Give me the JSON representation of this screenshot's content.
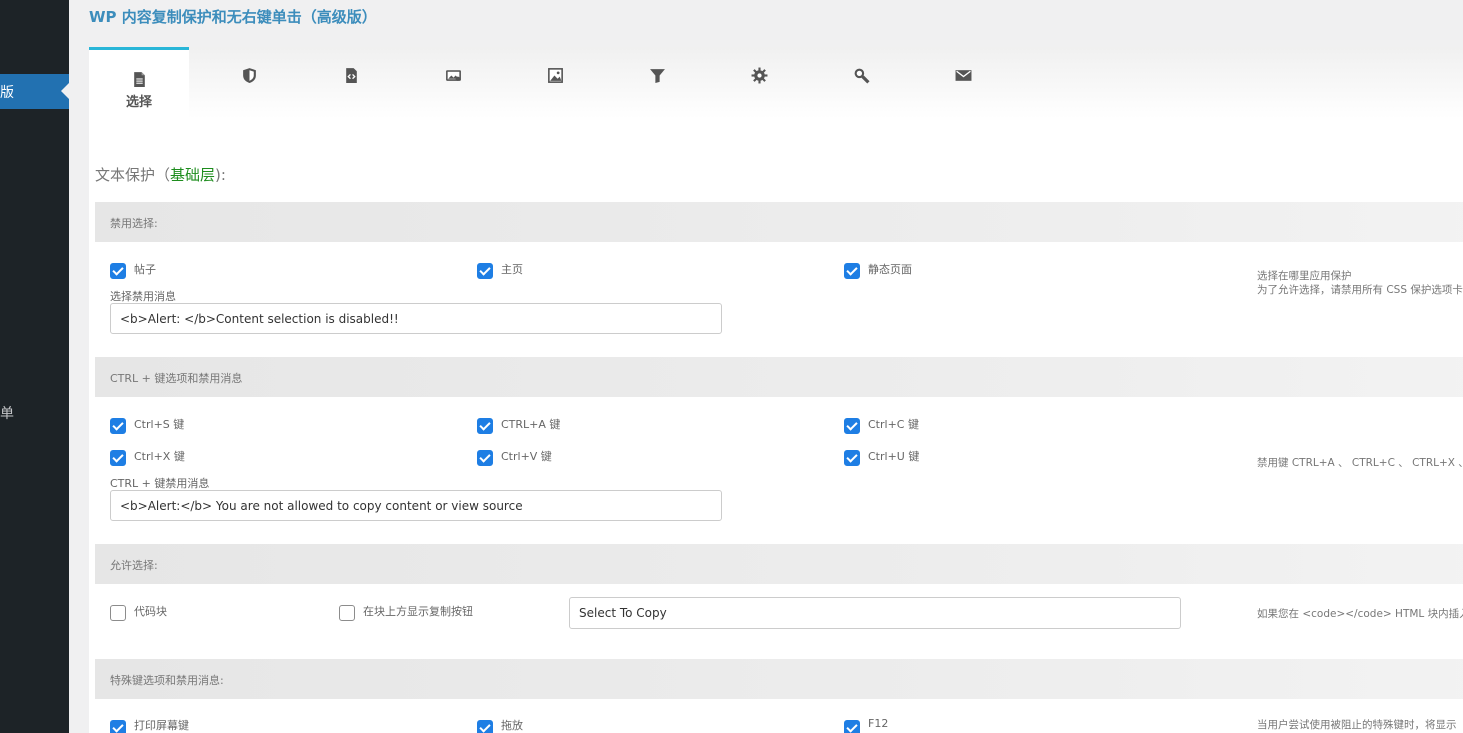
{
  "sidebar": {
    "active_label": "版",
    "item_label": "单"
  },
  "page": {
    "title": "WP 内容复制保护和无右键单击（高级版）"
  },
  "tabs": [
    {
      "icon": "document-icon",
      "label": "选择",
      "active": true
    },
    {
      "icon": "shield-icon",
      "label": ""
    },
    {
      "icon": "code-file-icon",
      "label": ""
    },
    {
      "icon": "image-card-icon",
      "label": ""
    },
    {
      "icon": "picture-icon",
      "label": ""
    },
    {
      "icon": "filter-icon",
      "label": ""
    },
    {
      "icon": "gear-icon",
      "label": ""
    },
    {
      "icon": "search-icon",
      "label": ""
    },
    {
      "icon": "mail-icon",
      "label": ""
    }
  ],
  "section": {
    "title_prefix": "文本保护（",
    "title_highlight": "基础层",
    "title_suffix": "):"
  },
  "disable_selection": {
    "header": "禁用选择:",
    "options": [
      {
        "label": "帖子",
        "checked": true
      },
      {
        "label": "主页",
        "checked": true
      },
      {
        "label": "静态页面",
        "checked": true
      }
    ],
    "message_label": "选择禁用消息",
    "message_value": "<b>Alert: </b>Content selection is disabled!!",
    "note_line1": "选择在哪里应用保护",
    "note_line2": "为了允许选择，请禁用所有 CSS 保护选项卡"
  },
  "ctrl_keys": {
    "header": "CTRL + 键选项和禁用消息",
    "options": [
      {
        "label": "Ctrl+S 键",
        "checked": true
      },
      {
        "label": "CTRL+A 键",
        "checked": true
      },
      {
        "label": "Ctrl+C 键",
        "checked": true
      },
      {
        "label": "Ctrl+X 键",
        "checked": true
      },
      {
        "label": "Ctrl+V 键",
        "checked": true
      },
      {
        "label": "Ctrl+U 键",
        "checked": true
      }
    ],
    "message_label": "CTRL + 键禁用消息",
    "message_value": "<b>Alert:</b> You are not allowed to copy content or view source",
    "note": "禁用键 CTRL+A 、 CTRL+C 、 CTRL+X 、"
  },
  "allow_selection": {
    "header": "允许选择:",
    "options": [
      {
        "label": "代码块",
        "checked": false
      },
      {
        "label": "在块上方显示复制按钮",
        "checked": false
      }
    ],
    "button_text_value": "Select To Copy",
    "note": "如果您在 <code></code> HTML 块内插入"
  },
  "special_keys": {
    "header": "特殊键选项和禁用消息:",
    "options": [
      {
        "label": "打印屏幕键",
        "checked": true
      },
      {
        "label": "拖放",
        "checked": true
      },
      {
        "label": "F12",
        "checked": true
      }
    ],
    "note": "当用户尝试使用被阻止的特殊键时，将显示"
  },
  "colors": {
    "accent": "#29b6d8",
    "title_blue": "#3c8dbc",
    "checkbox_blue": "#1e7ee4",
    "highlight_green": "#1e8d1e",
    "sidebar_bg": "#1d2327",
    "sidebar_active": "#2271b1"
  }
}
